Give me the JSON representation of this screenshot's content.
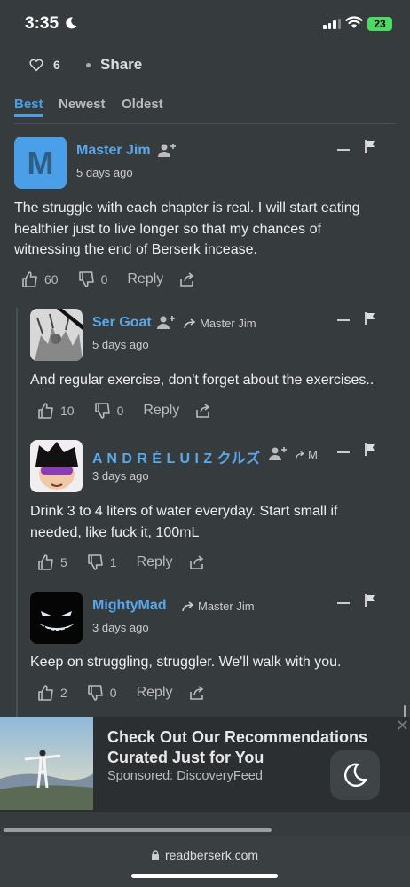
{
  "status_bar": {
    "time": "3:35",
    "battery": "23"
  },
  "top_actions": {
    "like_count": "6",
    "share_label": "Share"
  },
  "tabs": [
    {
      "label": "Best",
      "active": true
    },
    {
      "label": "Newest",
      "active": false
    },
    {
      "label": "Oldest",
      "active": false
    }
  ],
  "comments": [
    {
      "avatar_letter": "M",
      "username": "Master Jim",
      "time": "5 days ago",
      "lines": [
        "The struggle with each chapter is real. I will start eating",
        "healthier just to live longer so that my chances of",
        "witnessing the end of Berserk incease."
      ],
      "upvotes": "60",
      "downvotes": "0",
      "reply_label": "Reply"
    },
    {
      "username": "Ser Goat",
      "reply_to": "Master Jim",
      "time": "5 days ago",
      "lines": [
        "And regular exercise, don't forget about the exercises.."
      ],
      "upvotes": "10",
      "downvotes": "0",
      "reply_label": "Reply"
    },
    {
      "username": "A N D R É L U I Z クルズ ☭",
      "reply_to": "M",
      "time": "3 days ago",
      "lines": [
        "Drink 3 to 4 liters of water everyday. Start small if",
        "needed, like fuck it, 100mL"
      ],
      "upvotes": "5",
      "downvotes": "1",
      "reply_label": "Reply"
    },
    {
      "username": "MightyMad",
      "reply_to": "Master Jim",
      "time": "3 days ago",
      "lines": [
        "Keep on struggling, struggler. We'll walk with you."
      ],
      "upvotes": "2",
      "downvotes": "0",
      "reply_label": "Reply"
    }
  ],
  "ad": {
    "title_line1": "Check Out Our Recommendations",
    "title_line2": "Curated Just for You",
    "sponsor": "Sponsored: DiscoveryFeed",
    "close": "✕"
  },
  "browser": {
    "url": "readberserk.com"
  },
  "colors": {
    "accent": "#4a9fe8",
    "background": "#363b3e",
    "battery": "#4cd964"
  }
}
